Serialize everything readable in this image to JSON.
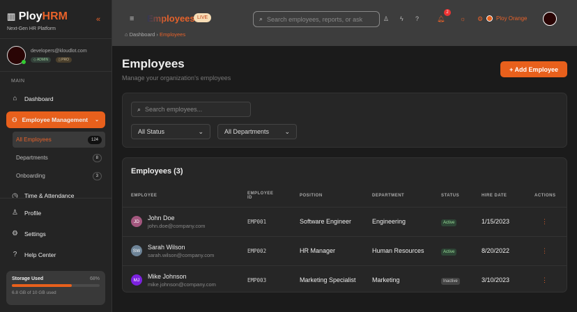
{
  "sidebar": {
    "brand_a": "Ploy",
    "brand_b": "HRM",
    "tagline": "Next-Gen HR Platform",
    "user_email": "developers@kloudlot.com",
    "badges": [
      "ADMIN",
      "PRO"
    ],
    "section": "MAIN",
    "dashboard": "Dashboard",
    "employee_management": "Employee Management",
    "sub": [
      {
        "label": "All Employees",
        "count": "124"
      },
      {
        "label": "Departments",
        "count": "8"
      },
      {
        "label": "Onboarding",
        "count": "3"
      }
    ],
    "time": "Time & Attendance",
    "profile": "Profile",
    "settings": "Settings",
    "help": "Help Center",
    "storage": {
      "label": "Storage Used",
      "percent_text": "68%",
      "percent": 68,
      "detail": "6.8 GB of 10 GB used"
    }
  },
  "topbar": {
    "title": "Employees",
    "live": "LIVE",
    "search_placeholder": "Search employees, reports, or ask",
    "notifications": "2",
    "org": "Ploy Orange",
    "breadcrumb": [
      "Dashboard",
      "Employees"
    ]
  },
  "page": {
    "title": "Employees",
    "subtitle": "Manage your organization's employees",
    "add_button": "+ Add Employee"
  },
  "filters": {
    "search_placeholder": "Search employees...",
    "status": "All Status",
    "department": "All Departments"
  },
  "table": {
    "title": "Employees (3)",
    "headers": [
      "EMPLOYEE",
      "EMPLOYEE ID",
      "POSITION",
      "DEPARTMENT",
      "STATUS",
      "HIRE DATE",
      "ACTIONS"
    ],
    "rows": [
      {
        "initials": "JD",
        "name": "John Doe",
        "email": "john.doe@company.com",
        "id": "EMP001",
        "position": "Software Engineer",
        "department": "Engineering",
        "status": "Active",
        "hire": "1/15/2023",
        "color": "#a3577e"
      },
      {
        "initials": "SW",
        "name": "Sarah Wilson",
        "email": "sarah.wilson@company.com",
        "id": "EMP002",
        "position": "HR Manager",
        "department": "Human Resources",
        "status": "Active",
        "hire": "8/20/2022",
        "color": "#6d8397"
      },
      {
        "initials": "MJ",
        "name": "Mike Johnson",
        "email": "mike.johnson@company.com",
        "id": "EMP003",
        "position": "Marketing Specialist",
        "department": "Marketing",
        "status": "Inactive",
        "hire": "3/10/2023",
        "color": "#7c22e0"
      }
    ]
  },
  "colors": {
    "accent": "#e8601c"
  }
}
